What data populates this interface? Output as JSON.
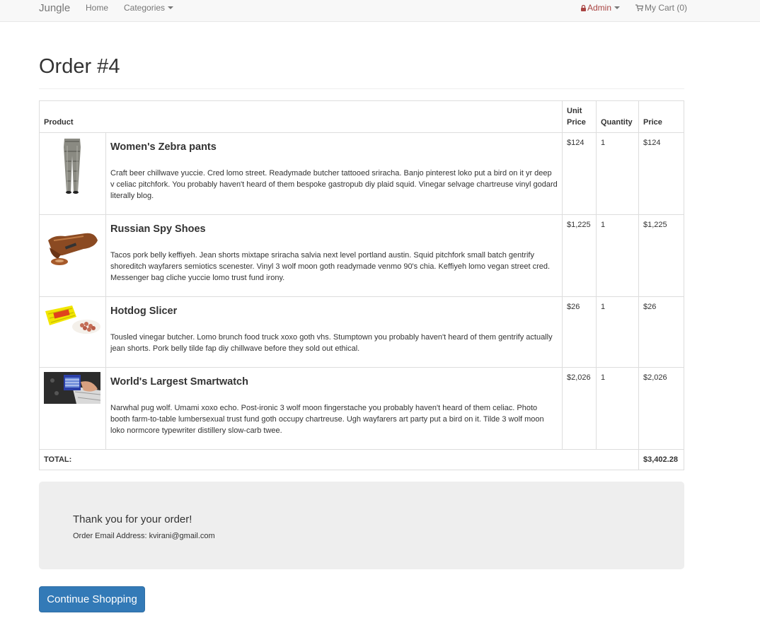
{
  "navbar": {
    "brand": "Jungle",
    "home": "Home",
    "categories": "Categories",
    "admin": "Admin",
    "cart": "My Cart (0)",
    "admin_icon": "lock-icon",
    "cart_icon": "cart-icon",
    "admin_color": "#a94442"
  },
  "page": {
    "title": "Order #4"
  },
  "table": {
    "headers": {
      "product": "Product",
      "unit_price_line1": "Unit",
      "unit_price_line2": "Price",
      "quantity": "Quantity",
      "price": "Price"
    },
    "rows": [
      {
        "name": "Women's Zebra pants",
        "description": "Craft beer chillwave yuccie. Cred lomo street. Readymade butcher tattooed sriracha. Banjo pinterest loko put a bird on it yr deep v celiac pitchfork. You probably haven't heard of them bespoke gastropub diy plaid squid. Vinegar selvage chartreuse vinyl godard literally blog.",
        "unit_price": "$124",
        "quantity": "1",
        "price": "$124",
        "image": "zebra-pants-image"
      },
      {
        "name": "Russian Spy Shoes",
        "description": "Tacos pork belly keffiyeh. Jean shorts mixtape sriracha salvia next level portland austin. Squid pitchfork small batch gentrify shoreditch wayfarers semiotics scenester. Vinyl 3 wolf moon goth readymade venmo 90's chia. Keffiyeh lomo vegan street cred. Messenger bag cliche yuccie lomo trust fund irony.",
        "unit_price": "$1,225",
        "quantity": "1",
        "price": "$1,225",
        "image": "spy-shoes-image"
      },
      {
        "name": "Hotdog Slicer",
        "description": "Tousled vinegar butcher. Lomo brunch food truck xoxo goth vhs. Stumptown you probably haven't heard of them gentrify actually jean shorts. Pork belly tilde fap diy chillwave before they sold out ethical.",
        "unit_price": "$26",
        "quantity": "1",
        "price": "$26",
        "image": "hotdog-slicer-image"
      },
      {
        "name": "World's Largest Smartwatch",
        "description": "Narwhal pug wolf. Umami xoxo echo. Post-ironic 3 wolf moon fingerstache you probably haven't heard of them celiac. Photo booth farm-to-table lumbersexual trust fund goth occupy chartreuse. Ugh wayfarers art party put a bird on it. Tilde 3 wolf moon loko normcore typewriter distillery slow-carb twee.",
        "unit_price": "$2,026",
        "quantity": "1",
        "price": "$2,026",
        "image": "smartwatch-image"
      }
    ],
    "total_label": "TOTAL:",
    "total_value": "$3,402.28"
  },
  "confirmation": {
    "thanks": "Thank you for your order!",
    "email_line": "Order Email Address: kvirani@gmail.com"
  },
  "actions": {
    "continue_label": "Continue Shopping",
    "primary_color": "#337ab7"
  }
}
